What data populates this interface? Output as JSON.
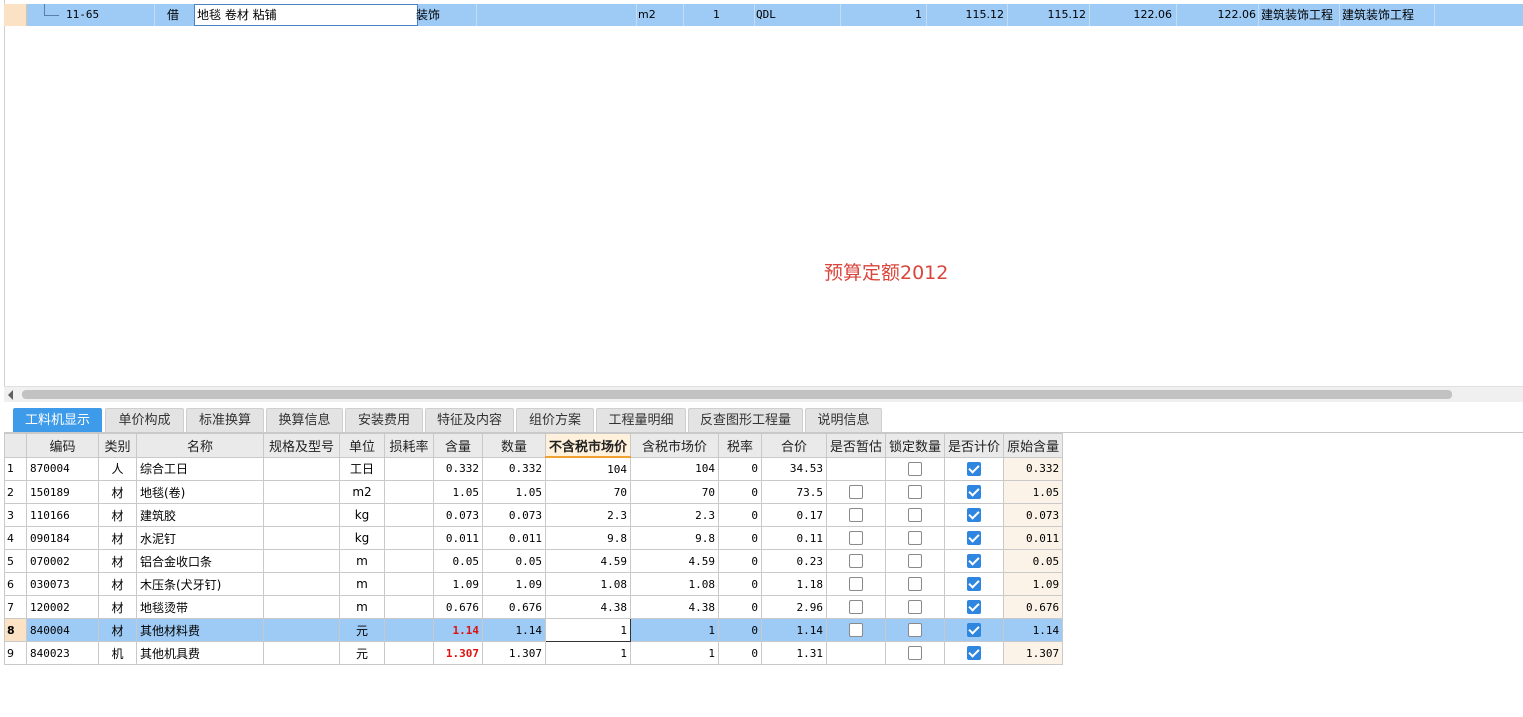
{
  "top_row": {
    "code": "11-65",
    "type": "借",
    "name": "地毯 卷材 粘铺",
    "major": "装饰",
    "unit": "m2",
    "qty_expr": "1",
    "qty_code": "QDL",
    "quantity": "1",
    "unit_price": "115.12",
    "total_price": "115.12",
    "comp_price": "122.06",
    "comp_total": "122.06",
    "discipline": "建筑装饰工程",
    "construction": "建筑装饰工程"
  },
  "watermark": "预算定额2012",
  "tabs": [
    "工料机显示",
    "单价构成",
    "标准换算",
    "换算信息",
    "安装费用",
    "特征及内容",
    "组价方案",
    "工程量明细",
    "反查图形工程量",
    "说明信息"
  ],
  "columns": [
    "编码",
    "类别",
    "名称",
    "规格及型号",
    "单位",
    "损耗率",
    "含量",
    "数量",
    "不含税市场价",
    "含税市场价",
    "税率",
    "合价",
    "是否暂估",
    "锁定数量",
    "是否计价",
    "原始含量"
  ],
  "rows": [
    {
      "n": "1",
      "code": "870004",
      "type": "人",
      "name": "综合工日",
      "spec": "",
      "unit": "工日",
      "loss": "",
      "content": "0.332",
      "qty": "0.332",
      "price": "104",
      "tax_price": "104",
      "tax": "0",
      "total": "34.53",
      "est": null,
      "lock": false,
      "priced": true,
      "orig": "0.332"
    },
    {
      "n": "2",
      "code": "150189",
      "type": "材",
      "name": "地毯(卷)",
      "spec": "",
      "unit": "m2",
      "loss": "",
      "content": "1.05",
      "qty": "1.05",
      "price": "70",
      "tax_price": "70",
      "tax": "0",
      "total": "73.5",
      "est": false,
      "lock": false,
      "priced": true,
      "orig": "1.05"
    },
    {
      "n": "3",
      "code": "110166",
      "type": "材",
      "name": "建筑胶",
      "spec": "",
      "unit": "kg",
      "loss": "",
      "content": "0.073",
      "qty": "0.073",
      "price": "2.3",
      "tax_price": "2.3",
      "tax": "0",
      "total": "0.17",
      "est": false,
      "lock": false,
      "priced": true,
      "orig": "0.073"
    },
    {
      "n": "4",
      "code": "090184",
      "type": "材",
      "name": "水泥钉",
      "spec": "",
      "unit": "kg",
      "loss": "",
      "content": "0.011",
      "qty": "0.011",
      "price": "9.8",
      "tax_price": "9.8",
      "tax": "0",
      "total": "0.11",
      "est": false,
      "lock": false,
      "priced": true,
      "orig": "0.011"
    },
    {
      "n": "5",
      "code": "070002",
      "type": "材",
      "name": "铝合金收口条",
      "spec": "",
      "unit": "m",
      "loss": "",
      "content": "0.05",
      "qty": "0.05",
      "price": "4.59",
      "tax_price": "4.59",
      "tax": "0",
      "total": "0.23",
      "est": false,
      "lock": false,
      "priced": true,
      "orig": "0.05"
    },
    {
      "n": "6",
      "code": "030073",
      "type": "材",
      "name": "木压条(犬牙钉)",
      "spec": "",
      "unit": "m",
      "loss": "",
      "content": "1.09",
      "qty": "1.09",
      "price": "1.08",
      "tax_price": "1.08",
      "tax": "0",
      "total": "1.18",
      "est": false,
      "lock": false,
      "priced": true,
      "orig": "1.09"
    },
    {
      "n": "7",
      "code": "120002",
      "type": "材",
      "name": "地毯烫带",
      "spec": "",
      "unit": "m",
      "loss": "",
      "content": "0.676",
      "qty": "0.676",
      "price": "4.38",
      "tax_price": "4.38",
      "tax": "0",
      "total": "2.96",
      "est": false,
      "lock": false,
      "priced": true,
      "orig": "0.676"
    },
    {
      "n": "8",
      "code": "840004",
      "type": "材",
      "name": "其他材料费",
      "spec": "",
      "unit": "元",
      "loss": "",
      "content": "1.14",
      "qty": "1.14",
      "price": "1",
      "tax_price": "1",
      "tax": "0",
      "total": "1.14",
      "est": false,
      "lock": false,
      "priced": true,
      "orig": "1.14"
    },
    {
      "n": "9",
      "code": "840023",
      "type": "机",
      "name": "其他机具费",
      "spec": "",
      "unit": "元",
      "loss": "",
      "content": "1.307",
      "qty": "1.307",
      "price": "1",
      "tax_price": "1",
      "tax": "0",
      "total": "1.31",
      "est": null,
      "lock": false,
      "priced": true,
      "orig": "1.307"
    }
  ],
  "selected_row": "8"
}
